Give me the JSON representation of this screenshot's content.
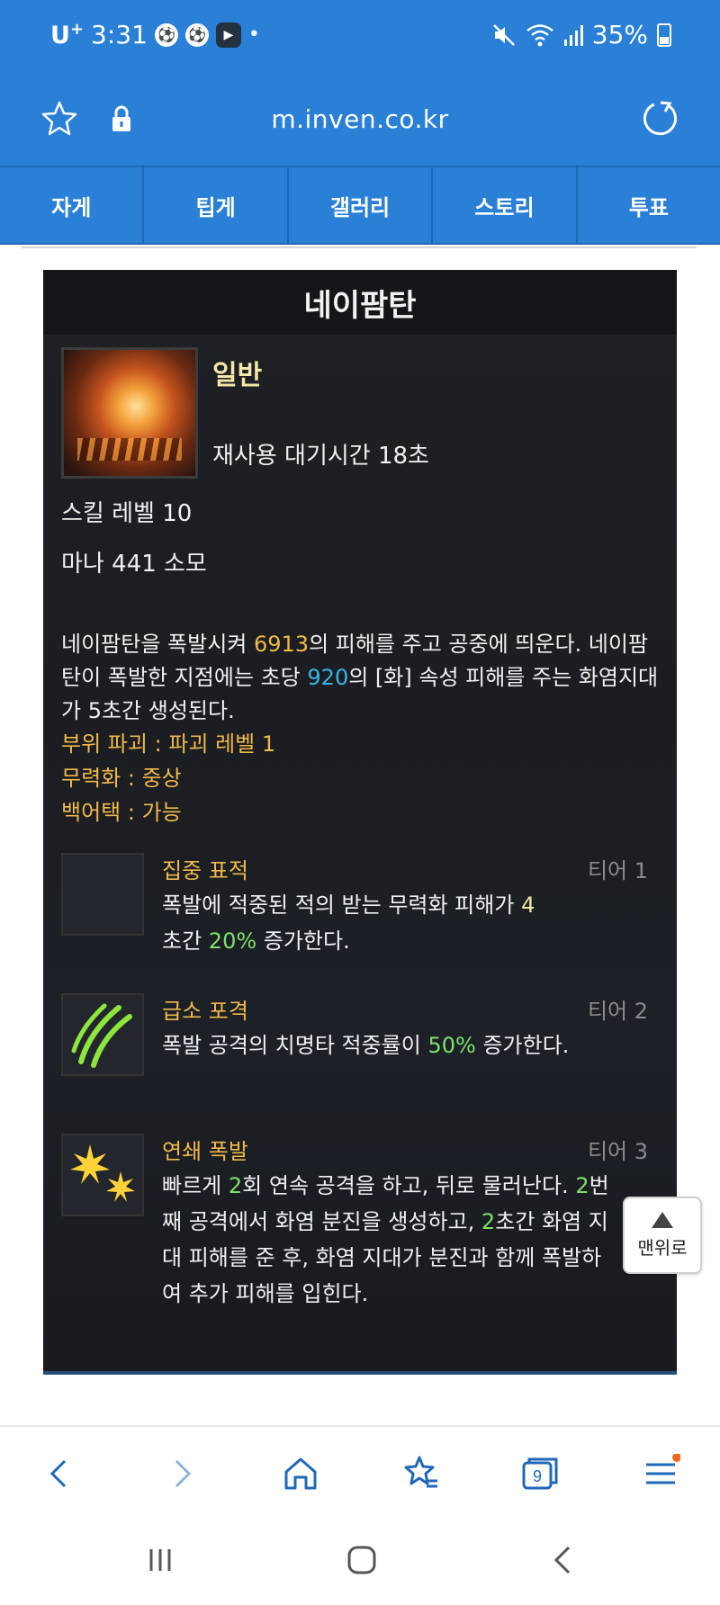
{
  "status_bar": {
    "carrier": "U",
    "carrier_sup": "+",
    "time": "3:31",
    "battery": "35%",
    "icons": [
      "soccer-ball-icon",
      "soccer-ball-icon",
      "play-app-icon",
      "mute-icon",
      "wifi-icon",
      "signal-icon",
      "battery-icon"
    ]
  },
  "url_bar": {
    "url": "m.inven.co.kr"
  },
  "tabs": [
    {
      "label": "자게"
    },
    {
      "label": "팁게"
    },
    {
      "label": "갤러리"
    },
    {
      "label": "스토리"
    },
    {
      "label": "투표"
    }
  ],
  "skill": {
    "title": "네이팜탄",
    "grade": "일반",
    "cooldown": "재사용 대기시간 18초",
    "level": "스킬 레벨 10",
    "mana": "마나 441 소모",
    "desc": {
      "p1": "네이팜탄을 폭발시켜 ",
      "damage": "6913",
      "p2": "의 피해를 주고 공중에 띄운다. 네이팜탄이 폭발한 지점에는 초당 ",
      "dot": "920",
      "p3": "의 [화] 속성 피해를 주는 화염지대가 5초간 생성된다."
    },
    "attributes": [
      "부위 파괴 : 파괴 레벨 1",
      "무력화 : 중상",
      "백어택 : 가능"
    ]
  },
  "tripods": [
    {
      "name": "집중 표적",
      "tier": "티어 1",
      "icon": "target-shatter-icon",
      "d1": "폭발에 적중된 적의 받는 무력화 피해가 ",
      "h1": "4",
      "d2": "초간 ",
      "h2": "20%",
      "d3": " 증가한다."
    },
    {
      "name": "급소 포격",
      "tier": "티어 2",
      "icon": "claw-slash-icon",
      "d1": "폭발 공격의 치명타 적중률이 ",
      "h1": "50%",
      "d2": " 증가한다."
    },
    {
      "name": "연쇄 폭발",
      "tier": "티어 3",
      "icon": "burst-explosion-icon",
      "d1": "빠르게 ",
      "h1": "2",
      "d2": "회 연속 공격을 하고, 뒤로 물러난다. ",
      "h2": "2",
      "d3": "번째 공격에서 화염 분진을 생성하고, ",
      "h3": "2",
      "d4": "초간 화염 지대 피해를 준 후, 화염 지대가 분진과 함께 폭발하여 추가 피해를 입힌다."
    }
  ],
  "back_to_top": "맨위로",
  "browser_bar": {
    "tab_count": "9",
    "notification_color": "#f26522"
  },
  "colors": {
    "brand_blue": "#2a7fd6",
    "gold_text": "#f0b94a",
    "blue_value": "#38b4e6",
    "green_value": "#7ee06a"
  }
}
